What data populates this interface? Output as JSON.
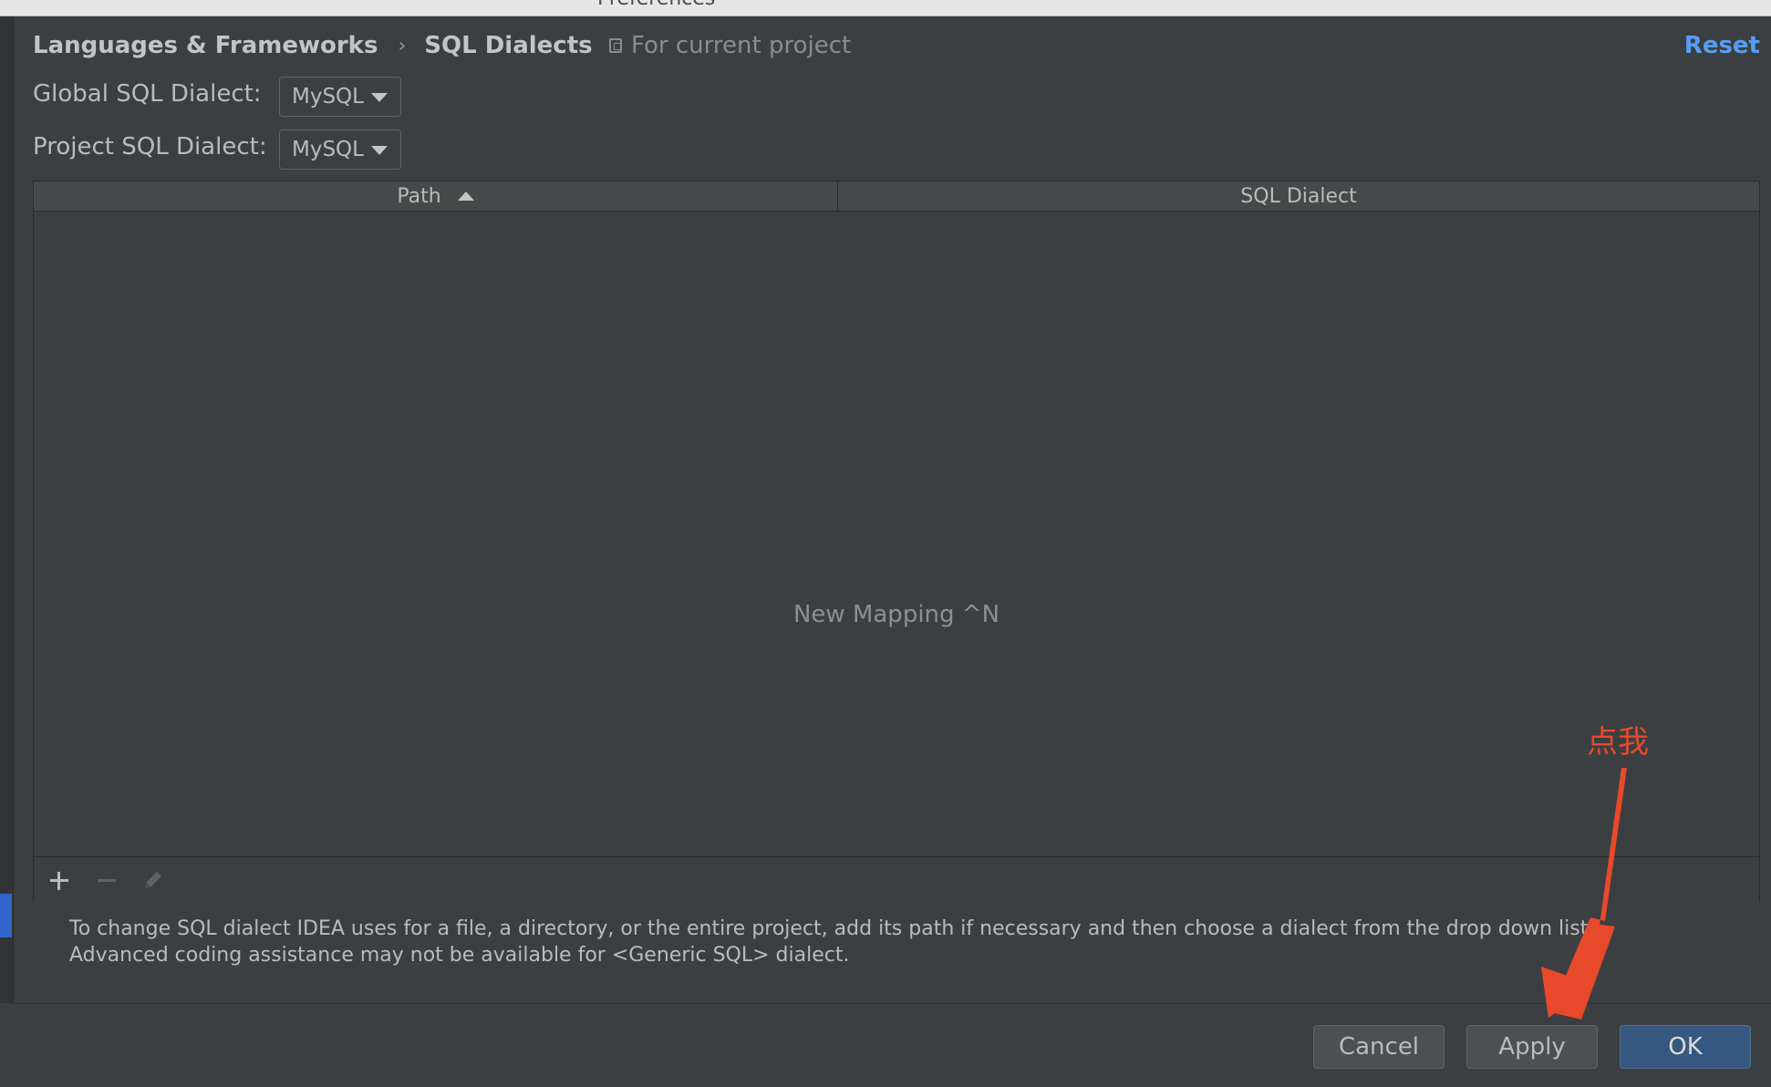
{
  "window": {
    "title": "Preferences"
  },
  "breadcrumb": {
    "parent": "Languages & Frameworks",
    "current": "SQL Dialects"
  },
  "scope": {
    "label": "For current project"
  },
  "header": {
    "reset_label": "Reset"
  },
  "settings": {
    "global": {
      "label": "Global SQL Dialect:",
      "value": "MySQL"
    },
    "project": {
      "label": "Project SQL Dialect:",
      "value": "MySQL"
    }
  },
  "table": {
    "columns": [
      "Path",
      "SQL Dialect"
    ],
    "sort_column": "Path",
    "sort_direction": "ascending",
    "empty_text": "New Mapping ^N"
  },
  "help_text": "To change SQL dialect IDEA uses for a file, a directory, or the entire project, add its path if necessary and then choose a dialect from the drop down list. Advanced coding assistance may not be available for <Generic SQL> dialect.",
  "buttons": {
    "cancel": "Cancel",
    "apply": "Apply",
    "ok": "OK"
  },
  "annotation": {
    "text": "点我",
    "color": "#e8492b"
  },
  "colors": {
    "background": "#3c3f41",
    "accent": "#589df6",
    "primary_button": "#365880"
  }
}
